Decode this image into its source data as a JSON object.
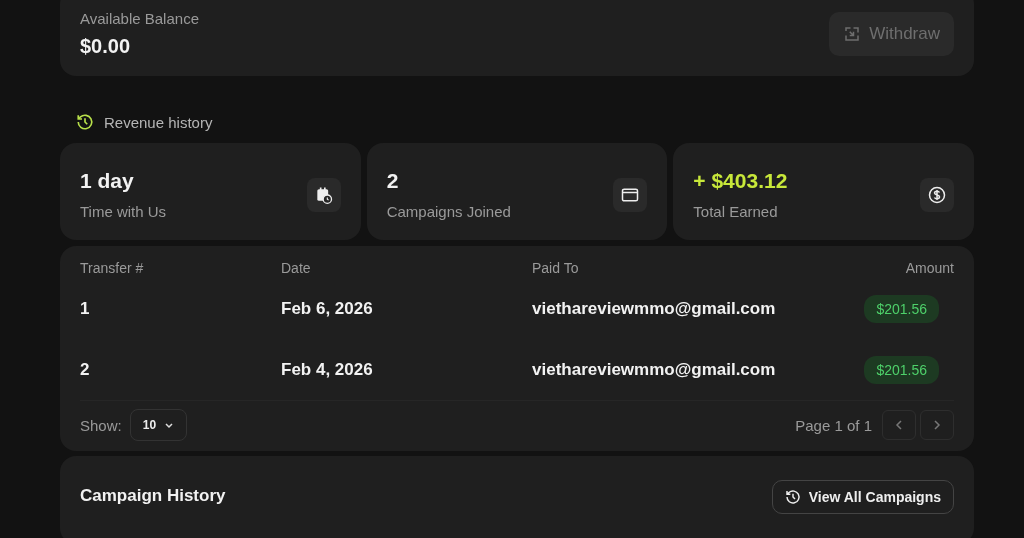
{
  "balance": {
    "label": "Available Balance",
    "value": "$0.00",
    "withdraw": {
      "label": "Withdraw",
      "disabled": true
    }
  },
  "section_title": "Revenue history",
  "stats": [
    {
      "value": "1 day",
      "label": "Time with Us",
      "kind": "time",
      "highlight": false
    },
    {
      "value": "2",
      "label": "Campaigns Joined",
      "kind": "campaigns",
      "highlight": false
    },
    {
      "value": "+ $403.12",
      "label": "Total Earned",
      "kind": "money",
      "highlight": true
    }
  ],
  "table": {
    "columns": [
      "Transfer #",
      "Date",
      "Paid To",
      "Amount"
    ],
    "rows": [
      {
        "transfer": "1",
        "date": "Feb 6, 2026",
        "paid_to": "viethareviewmmo@gmail.com",
        "amount": "$201.56"
      },
      {
        "transfer": "2",
        "date": "Feb 4, 2026",
        "paid_to": "viethareviewmmo@gmail.com",
        "amount": "$201.56"
      }
    ],
    "show_label": "Show:",
    "page_size": "10",
    "page_info": "Page 1 of 1",
    "prev_disabled": true,
    "next_disabled": true
  },
  "campaign_history": {
    "title": "Campaign History",
    "button": "View All Campaigns"
  }
}
